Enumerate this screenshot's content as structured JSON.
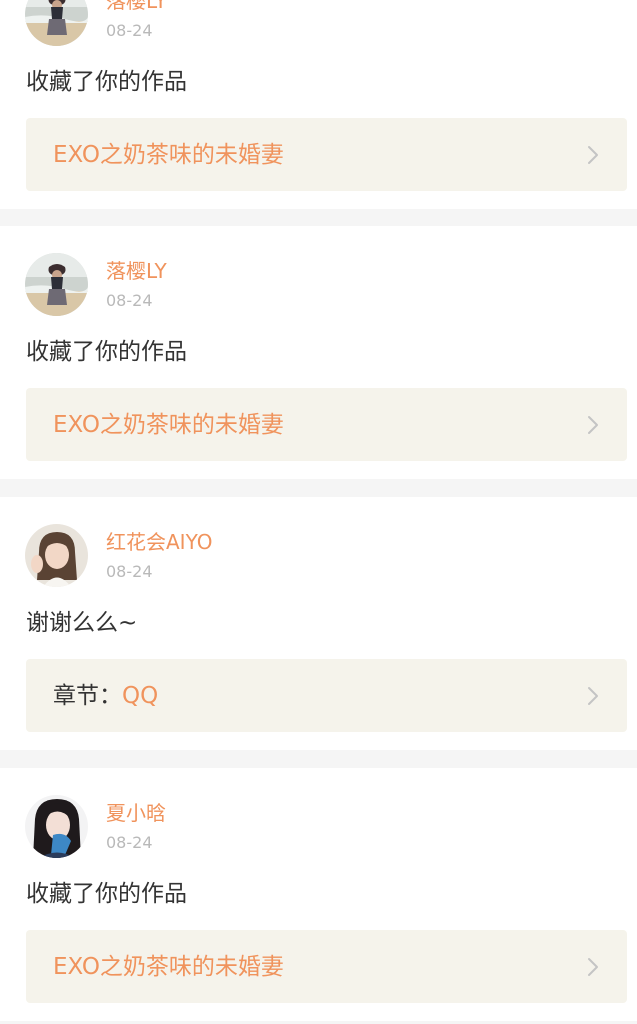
{
  "notifications": [
    {
      "username": "落樱LY",
      "date": "08-24",
      "message": "收藏了你的作品",
      "target_prefix": "",
      "target_title": "EXO之奶茶味的未婚妻",
      "avatar_icon": "avatar-photo-girl-beach"
    },
    {
      "username": "落樱LY",
      "date": "08-24",
      "message": "收藏了你的作品",
      "target_prefix": "",
      "target_title": "EXO之奶茶味的未婚妻",
      "avatar_icon": "avatar-photo-girl-beach"
    },
    {
      "username": "红花会AIYO",
      "date": "08-24",
      "message": "谢谢么么~",
      "target_prefix": "章节：",
      "target_title": "QQ",
      "avatar_icon": "avatar-photo-girl-waving"
    },
    {
      "username": "夏小晗",
      "date": "08-24",
      "message": "收藏了你的作品",
      "target_prefix": "",
      "target_title": "EXO之奶茶味的未婚妻",
      "avatar_icon": "avatar-photo-girl-dark-hair"
    }
  ],
  "colors": {
    "accent": "#f0935c",
    "text": "#333333",
    "date": "#b9b9b9",
    "target_background": "#f5f3eb",
    "page_background": "#f5f5f5"
  }
}
